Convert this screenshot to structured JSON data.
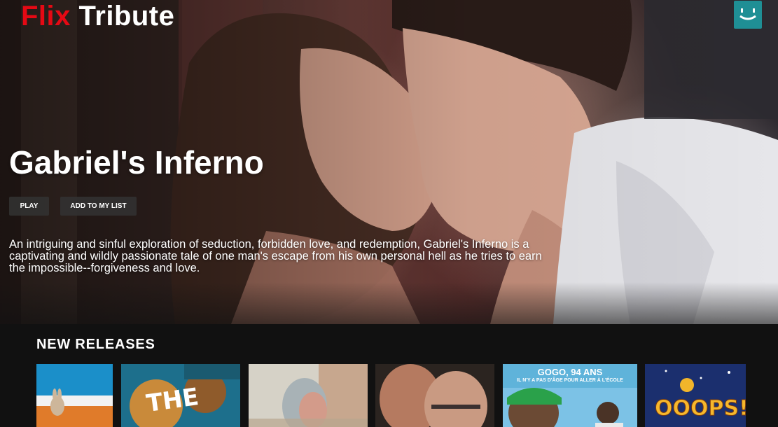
{
  "header": {
    "logo_part1": "Flix",
    "logo_part2": "Tribute",
    "avatar_icon": "smiley-icon"
  },
  "hero": {
    "title": "Gabriel's Inferno",
    "play_label": "PLAY",
    "add_list_label": "ADD TO MY LIST",
    "description": "An intriguing and sinful exploration of seduction, forbidden love, and redemption, Gabriel's Inferno is a captivating and wildly passionate tale of one man's escape from his own personal hell as he tries to earn the impossible--forgiveness and love."
  },
  "row": {
    "title": "NEW RELEASES",
    "posters": [
      {
        "name": "poster-1",
        "text": ""
      },
      {
        "name": "poster-2",
        "text": "THE"
      },
      {
        "name": "poster-3",
        "text": ""
      },
      {
        "name": "poster-4",
        "text": ""
      },
      {
        "name": "poster-5",
        "text": "GOGO, 94 ANS",
        "subtext": "IL N'Y A PAS D'ÂGE POUR ALLER À L'ÉCOLE"
      },
      {
        "name": "poster-6",
        "text": "OOOPS!"
      }
    ]
  },
  "colors": {
    "brand_red": "#e50914",
    "avatar_teal": "#1f8f95",
    "background": "#111111",
    "button_bg": "#333333"
  }
}
